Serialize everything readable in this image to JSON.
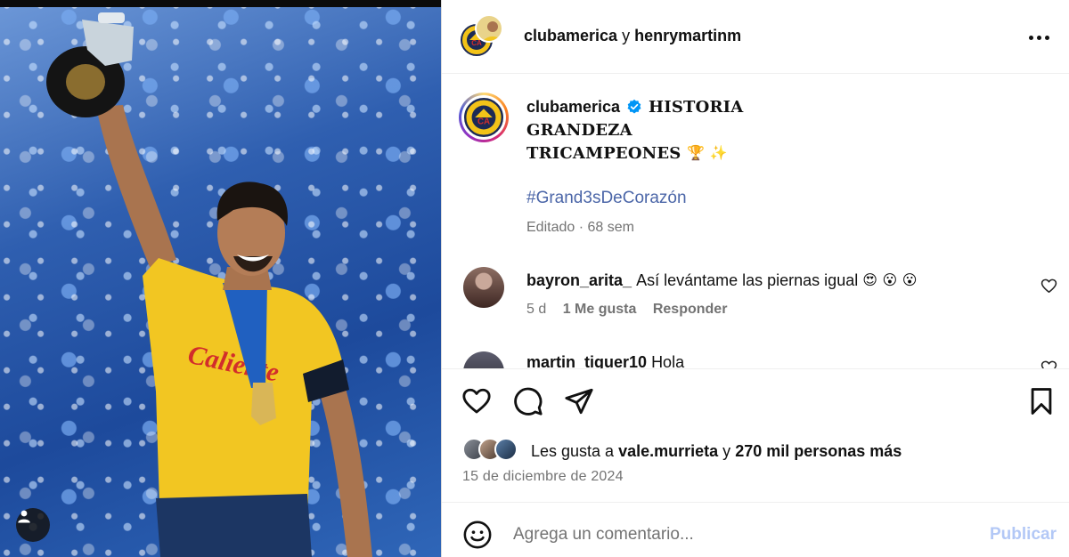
{
  "header": {
    "account_primary": "clubamerica",
    "joiner": "y",
    "account_secondary": "henrymartinm",
    "more_icon": "ellipsis-icon"
  },
  "caption": {
    "username": "clubamerica",
    "line1": "HISTORIA",
    "line2": "GRANDEZA",
    "line3": "TRICAMPEONES",
    "line3_emojis": "🏆 ✨",
    "hashtag": "#Grand3sDeCorazón",
    "edited": "Editado",
    "separator": "·",
    "age": "68 sem"
  },
  "comments": [
    {
      "username": "bayron_arita_",
      "text": "Así levántame las piernas igual",
      "emojis": "😍 😮 😮",
      "age": "5 d",
      "likes": "1 Me gusta",
      "reply": "Responder"
    },
    {
      "username": "martin_tiguer10",
      "text": "Hola"
    }
  ],
  "actions": {
    "like_icon": "heart-icon",
    "comment_icon": "comment-icon",
    "share_icon": "paper-plane-icon",
    "save_icon": "bookmark-icon"
  },
  "likes": {
    "prefix": "Les gusta a",
    "user": "vale.murrieta",
    "joiner": "y",
    "others": "270 mil personas más"
  },
  "date": "15 de diciembre de 2024",
  "comment_box": {
    "placeholder": "Agrega un comentario...",
    "publish_label": "Publicar"
  },
  "colors": {
    "link": "#4b66a8",
    "publish_disabled": "#b3c8f6",
    "muted": "#737373",
    "verified": "#0095f6"
  }
}
